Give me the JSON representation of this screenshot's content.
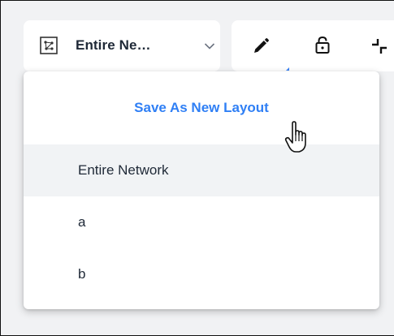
{
  "layout_selector": {
    "selected": "Entire Ne…",
    "icon": "network-map-icon",
    "chevron": "chevron-down-icon"
  },
  "toolbar": {
    "tools": [
      "edit-pencil-icon",
      "lock-icon",
      "compress-arrows-icon"
    ]
  },
  "dropdown": {
    "save_label": "Save As New Layout",
    "items": [
      {
        "label": "Entire Network",
        "active": true
      },
      {
        "label": "a",
        "active": false
      },
      {
        "label": "b",
        "active": false
      }
    ]
  },
  "colors": {
    "accent": "#2f7ff5",
    "text": "#1f2937",
    "background": "#f1f2f4",
    "hover_row": "#f1f3f5"
  },
  "cursor": "hand-pointer-icon"
}
